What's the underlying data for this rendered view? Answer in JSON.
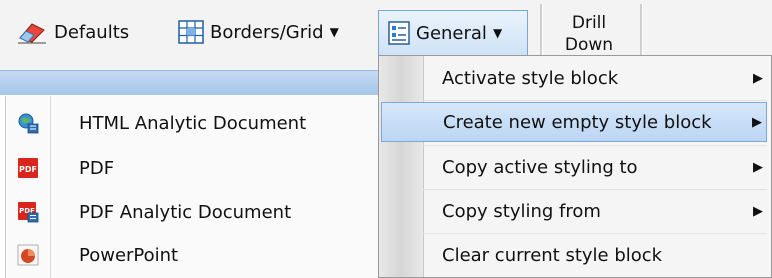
{
  "toolbar": {
    "defaults_label": "Defaults",
    "borders_label": "Borders/Grid",
    "general_label": "General",
    "drill_label_line1": "Drill",
    "drill_label_line2": "Down",
    "dropdown_arrow": "▼"
  },
  "output_formats": [
    {
      "label": "HTML Analytic Document",
      "icon": "html-analytic-icon"
    },
    {
      "label": "PDF",
      "icon": "pdf-icon"
    },
    {
      "label": "PDF Analytic Document",
      "icon": "pdf-analytic-icon"
    },
    {
      "label": "PowerPoint",
      "icon": "powerpoint-icon"
    }
  ],
  "general_menu": {
    "items": [
      {
        "label": "Activate style block",
        "submenu": true
      },
      {
        "label": "Create new empty style block",
        "submenu": true,
        "highlighted": true
      },
      {
        "label": "Copy active styling to",
        "submenu": true
      },
      {
        "label": "Copy styling from",
        "submenu": true
      },
      {
        "label": "Clear current style block",
        "submenu": false
      }
    ],
    "submenu_arrow": "▶"
  },
  "colors": {
    "highlight": "#bcd6f4",
    "band": "#b4cff0",
    "pdf_red": "#d9261c"
  }
}
